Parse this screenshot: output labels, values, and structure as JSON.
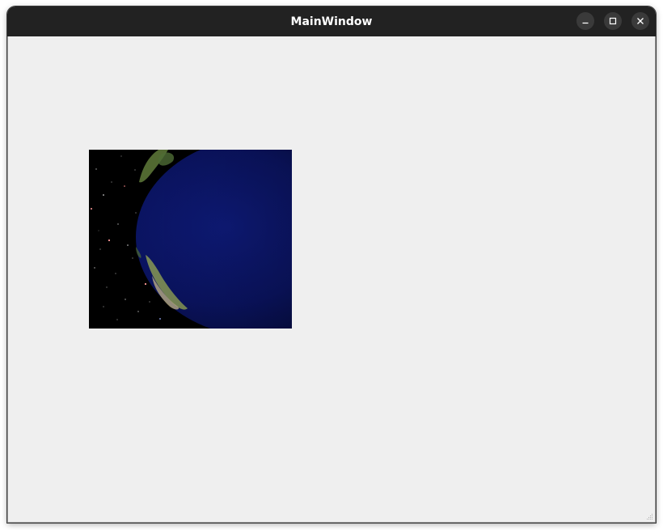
{
  "window": {
    "title": "MainWindow"
  },
  "icons": {
    "minimize": "minimize-icon",
    "maximize": "maximize-icon",
    "close": "close-icon"
  },
  "colors": {
    "titlebar": "#222222",
    "client_background": "#efefef",
    "button_background": "#3a3a3a"
  },
  "image": {
    "subject": "earth-from-space"
  }
}
